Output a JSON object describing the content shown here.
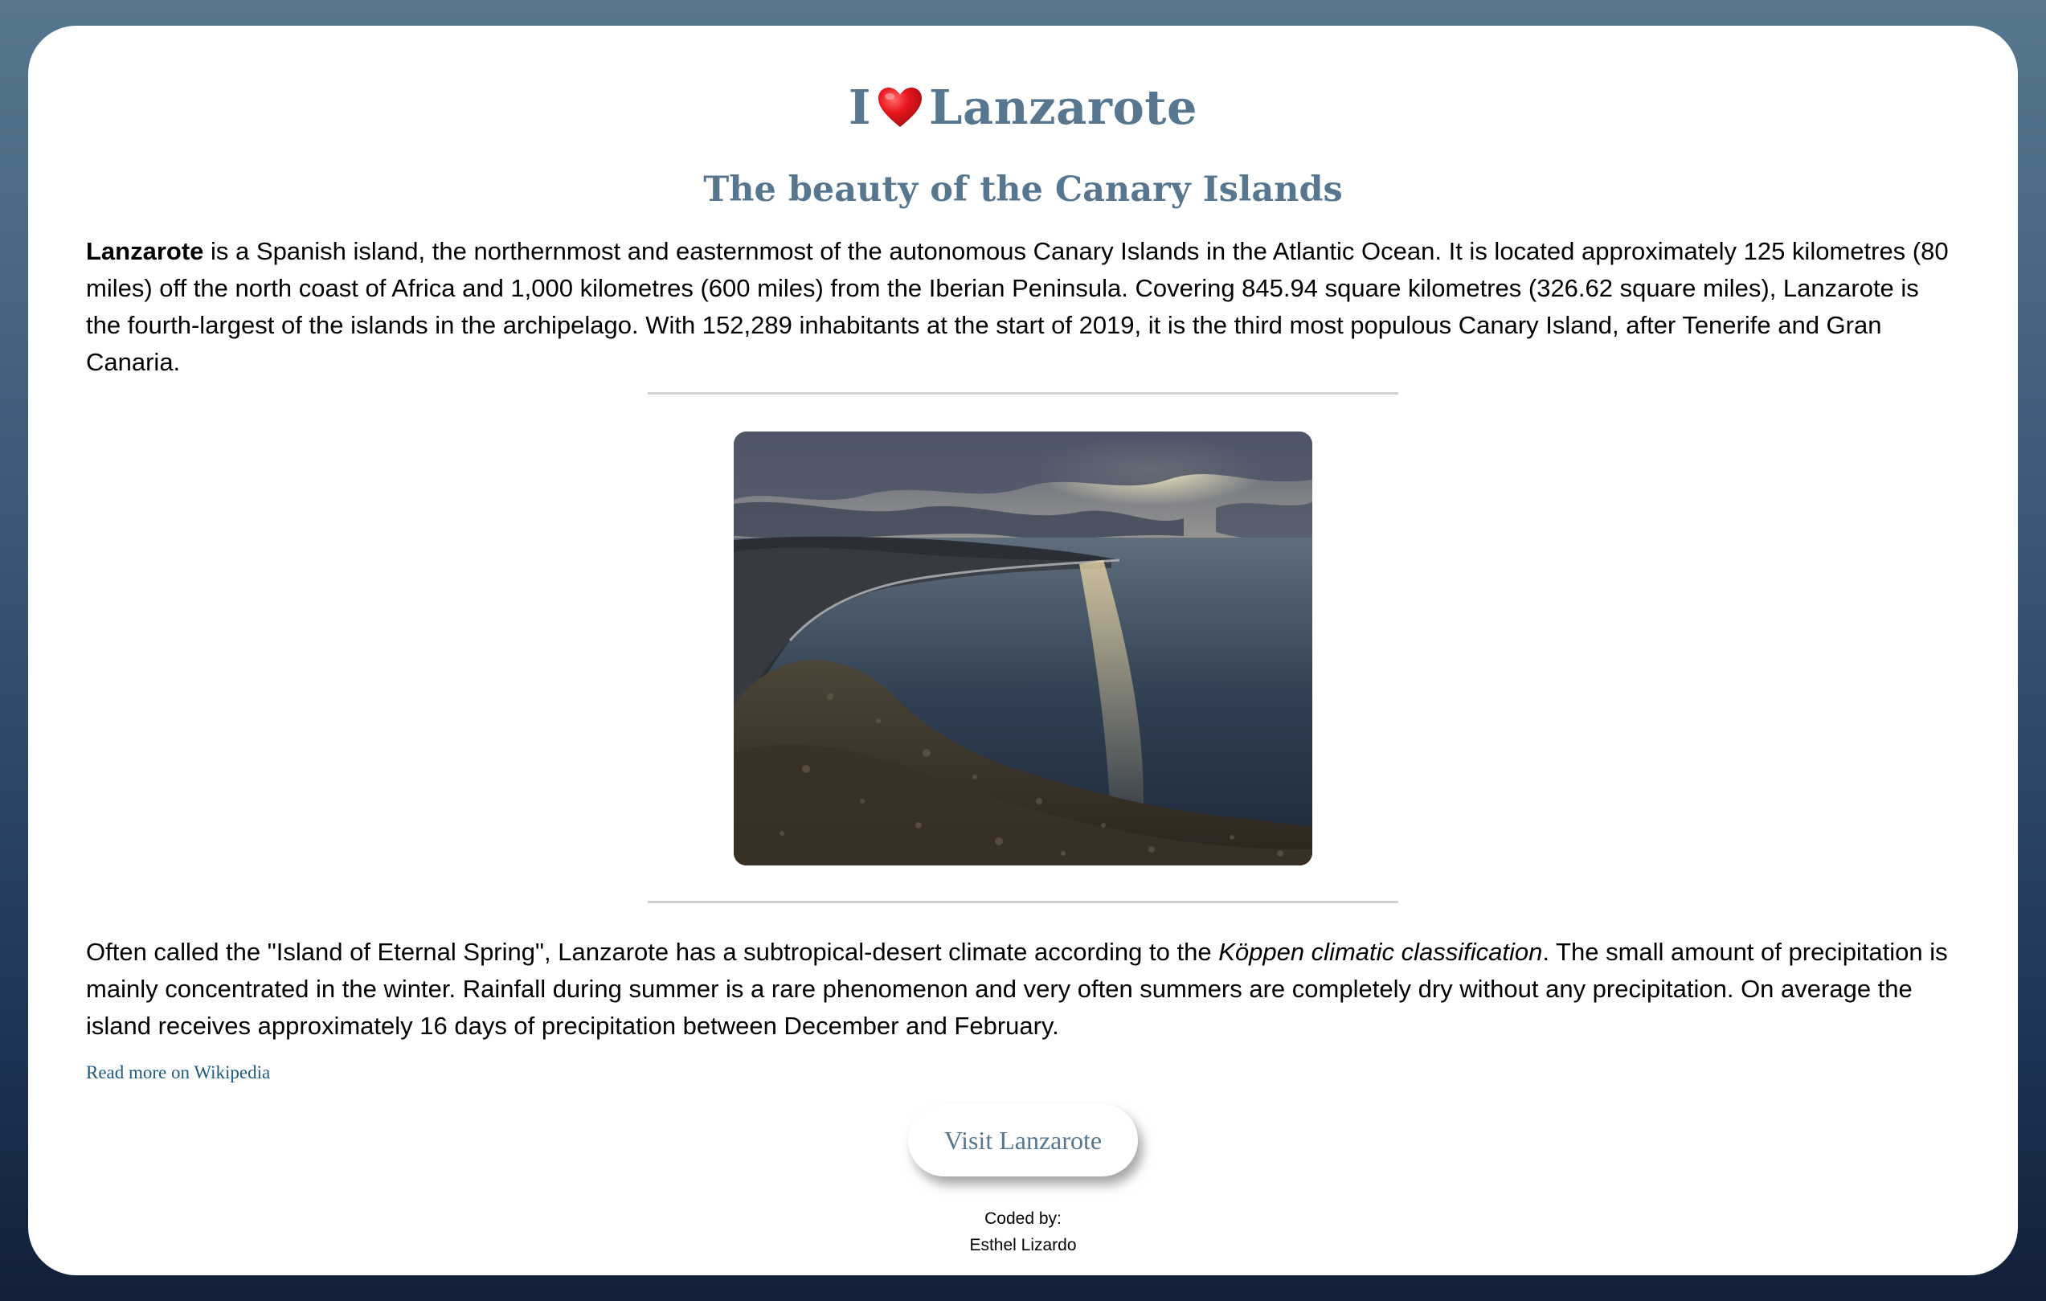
{
  "header": {
    "title_before": "I",
    "title_after": "Lanzarote",
    "subtitle": "The beauty of the Canary Islands"
  },
  "intro": {
    "bold": "Lanzarote",
    "text": " is a Spanish island, the northernmost and easternmost of the autonomous Canary Islands in the Atlantic Ocean. It is located approximately 125 kilometres (80 miles) off the north coast of Africa and 1,000 kilometres (600 miles) from the Iberian Peninsula. Covering 845.94 square kilometres (326.62 square miles), Lanzarote is the fourth-largest of the islands in the archipelago. With 152,289 inhabitants at the start of 2019, it is the third most populous Canary Island, after Tenerife and Gran Canaria."
  },
  "climate": {
    "before": "Often called the \"Island of Eternal Spring\", Lanzarote has a subtropical-desert climate according to the ",
    "italic": "Köppen climatic classification",
    "after": ". The small amount of precipitation is mainly concentrated in the winter. Rainfall during summer is a rare phenomenon and very often summers are completely dry without any precipitation. On average the island receives approximately 16 days of precipitation between December and February."
  },
  "links": {
    "wikipedia": "Read more on Wikipedia"
  },
  "button": {
    "visit": "Visit Lanzarote"
  },
  "footer": {
    "coded_by": "Coded by:",
    "author": "Esthel Lizardo"
  },
  "colors": {
    "heading": "#56778f",
    "link": "#1d5a80",
    "heart": "#e0161d"
  },
  "icons": {
    "heart": "red-heart-emoji"
  }
}
